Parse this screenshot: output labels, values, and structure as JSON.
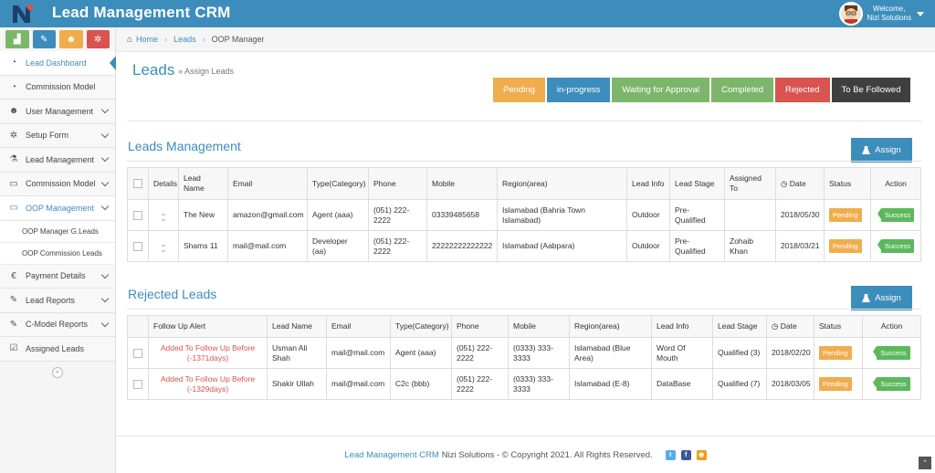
{
  "header": {
    "title": "Lead Management CRM",
    "welcome": "Welcome,",
    "user_name": "Nizi Solutions"
  },
  "sidebar": {
    "items": [
      {
        "label": "Lead Dashboard",
        "icon": "dashboard-icon"
      },
      {
        "label": "Commission Model",
        "icon": "dashboard-icon"
      },
      {
        "label": "User Management",
        "icon": "users-icon"
      },
      {
        "label": "Setup Form",
        "icon": "gears-icon"
      },
      {
        "label": "Lead Management",
        "icon": "flask-icon"
      },
      {
        "label": "Commission Model",
        "icon": "monitor-icon"
      },
      {
        "label": "OOP Management",
        "icon": "monitor-icon"
      },
      {
        "label": "OOP Manager G.Leads"
      },
      {
        "label": "OOP Commission Leads"
      },
      {
        "label": "Payment Details",
        "icon": "euro-icon"
      },
      {
        "label": "Lead Reports",
        "icon": "edit-icon"
      },
      {
        "label": "C-Model Reports",
        "icon": "edit-icon"
      },
      {
        "label": "Assigned Leads",
        "icon": "check-square-icon"
      }
    ],
    "collapse": "«"
  },
  "breadcrumb": {
    "home": "Home",
    "leads": "Leads",
    "current": "OOP Manager"
  },
  "page": {
    "title": "Leads",
    "subtitle": "» Assign Leads"
  },
  "status_buttons": [
    {
      "label": "Pending",
      "color": "#f0ad4e"
    },
    {
      "label": "in-progress",
      "color": "#3c8dbc"
    },
    {
      "label": "Waiting for Approval",
      "color": "#7cb66a"
    },
    {
      "label": "Completed",
      "color": "#7cb66a"
    },
    {
      "label": "Rejected",
      "color": "#d9534f"
    },
    {
      "label": "To Be Followed",
      "color": "#3f3f3f"
    }
  ],
  "leads_management": {
    "title": "Leads Management",
    "assign": "Assign",
    "headers": [
      "Details",
      "Lead Name",
      "Email",
      "Type(Category)",
      "Phone",
      "Mobile",
      "Region(area)",
      "Lead Info",
      "Lead Stage",
      "Assigned To",
      "Date",
      "Status",
      "Action"
    ],
    "rows": [
      {
        "name": "The New",
        "email": "amazon@gmail.com",
        "type": "Agent (aaa)",
        "phone": "(051) 222-2222",
        "mobile": "03339485658",
        "region": "Islamabad (Bahria Town Islamabad)",
        "info": "Outdoor",
        "stage": "Pre-Qualified",
        "assigned": "",
        "date": "2018/05/30",
        "status": "Pending",
        "action": "Success"
      },
      {
        "name": "Shams 11",
        "email": "mail@mail.com",
        "type": "Developer (aa)",
        "phone": "(051) 222-2222",
        "mobile": "22222222222222",
        "region": "Islamabad (Aabpara)",
        "info": "Outdoor",
        "stage": "Pre-Qualified",
        "assigned": "Zohaib Khan",
        "date": "2018/03/21",
        "status": "Pending",
        "action": "Success"
      }
    ]
  },
  "rejected_leads": {
    "title": "Rejected Leads",
    "assign": "Assign",
    "headers": [
      "Follow Up Alert",
      "Lead Name",
      "Email",
      "Type(Category)",
      "Phone",
      "Mobile",
      "Region(area)",
      "Lead Info",
      "Lead Stage",
      "Date",
      "Status",
      "Action"
    ],
    "rows": [
      {
        "alert": "Added To Follow Up Before (-1371days)",
        "name": "Usman Ali Shah",
        "email": "mail@mail.com",
        "type": "Agent (aaa)",
        "phone": "(051) 222-2222",
        "mobile": "(0333) 333-3333",
        "region": "Islamabad (Blue Area)",
        "info": "Word Of Mouth",
        "stage": "Qualified (3)",
        "date": "2018/02/20",
        "status": "Pending",
        "action": "Success"
      },
      {
        "alert": "Added To Follow Up Before (-1329days)",
        "name": "Shakir Ullah",
        "email": "mail@mail.com",
        "type": "C2c (bbb)",
        "phone": "(051) 222-2222",
        "mobile": "(0333) 333-3333",
        "region": "Islamabad (E-8)",
        "info": "DataBase",
        "stage": "Qualified (7)",
        "date": "2018/03/05",
        "status": "Pending",
        "action": "Success"
      }
    ]
  },
  "footer": {
    "brand": "Lead Management CRM",
    "text": "Nizi Solutions - © Copyright 2021. All Rights Reserved."
  }
}
